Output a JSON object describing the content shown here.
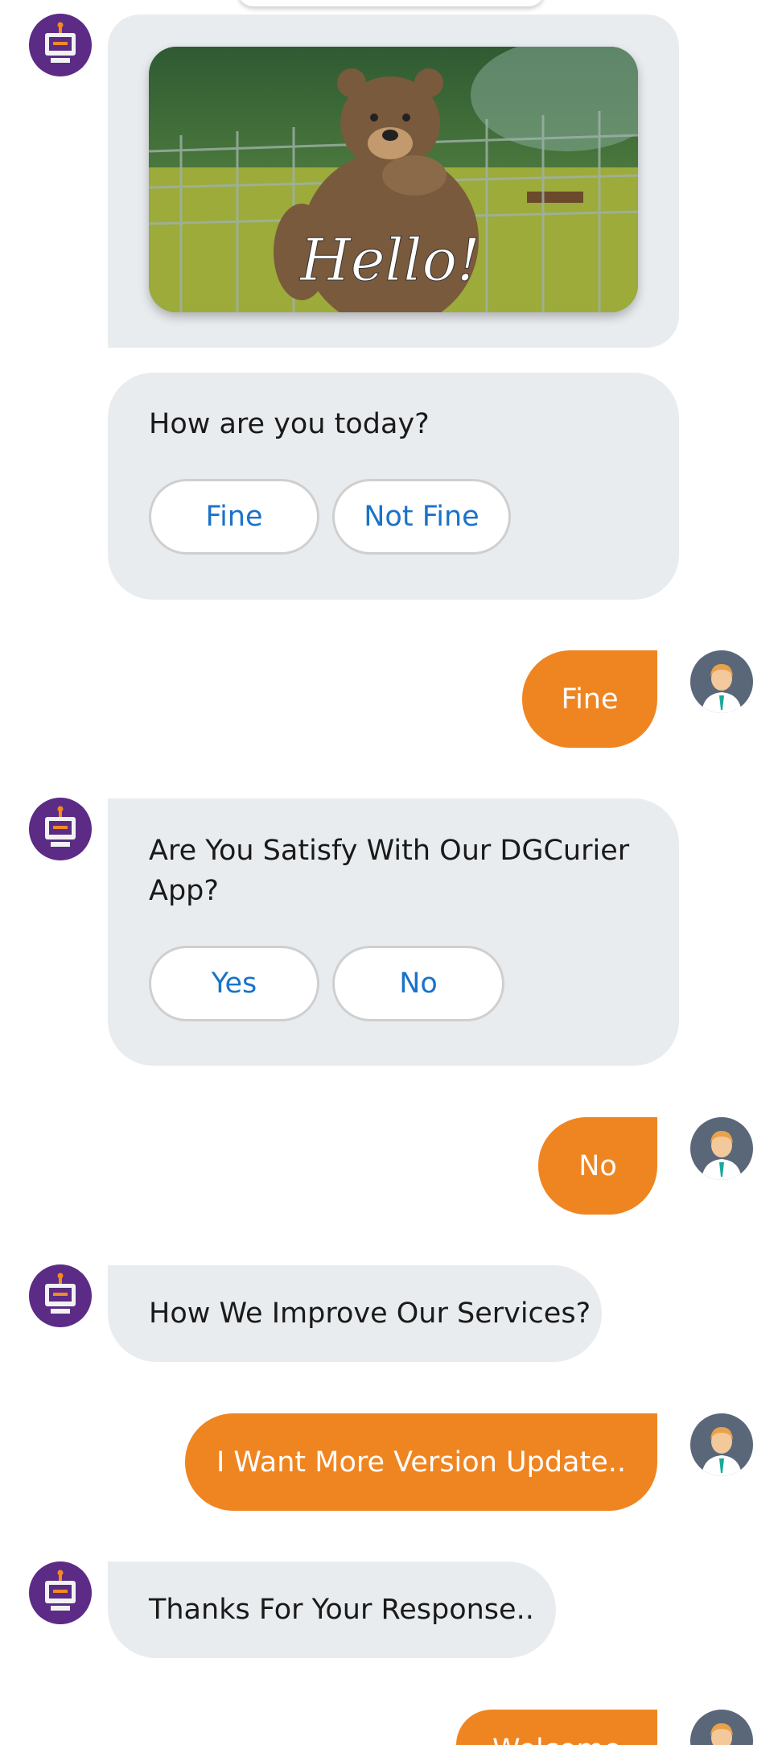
{
  "theme": {
    "user_bubble": "#ef8521",
    "bot_bubble": "#e9ecef",
    "bot_avatar": "#5b2b86",
    "user_avatar": "#596779",
    "option_text": "#1a73c9"
  },
  "icons": {
    "bot": "robot-icon",
    "user": "user-icon"
  },
  "gif_card": {
    "caption": "Hello!"
  },
  "messages": {
    "q1": {
      "text": "How are you today?",
      "options": [
        "Fine",
        "Not Fine"
      ]
    },
    "a1": {
      "text": "Fine"
    },
    "q2": {
      "text": "Are You Satisfy With Our DGCurier App?",
      "options": [
        "Yes",
        "No"
      ]
    },
    "a2": {
      "text": "No"
    },
    "q3": {
      "text": "How We Improve Our Services?"
    },
    "a3": {
      "text": "I Want More Version Update.."
    },
    "q4": {
      "text": "Thanks For Your Response.."
    },
    "a4": {
      "text": "Welcome"
    }
  }
}
